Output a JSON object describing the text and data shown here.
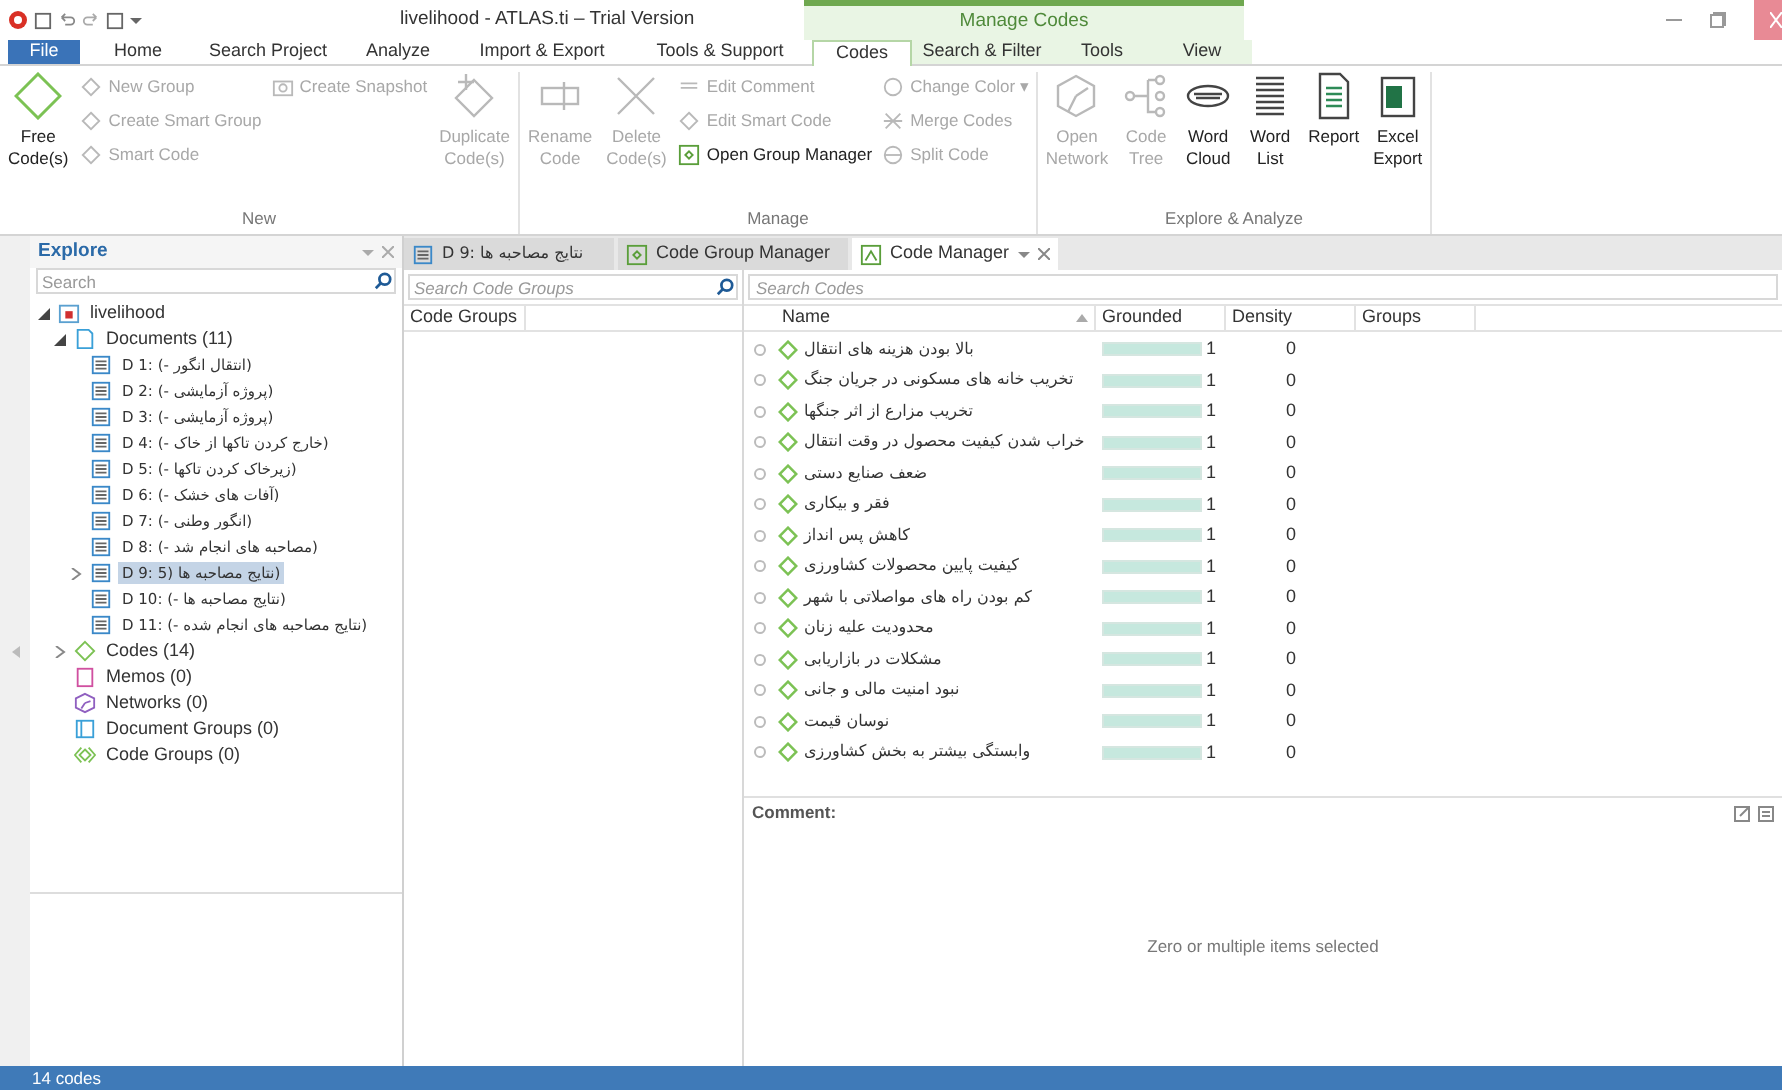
{
  "window": {
    "title": "livelihood - ATLAS.ti – Trial Version",
    "context_title": "Manage Codes"
  },
  "menu_tabs": [
    {
      "label": "File",
      "kind": "file",
      "selected": false,
      "context": false
    },
    {
      "label": "Home",
      "kind": "tab",
      "selected": false,
      "context": false
    },
    {
      "label": "Search Project",
      "kind": "tab",
      "selected": false,
      "context": false
    },
    {
      "label": "Analyze",
      "kind": "tab",
      "selected": false,
      "context": false
    },
    {
      "label": "Import & Export",
      "kind": "tab",
      "selected": false,
      "context": false
    },
    {
      "label": "Tools & Support",
      "kind": "tab",
      "selected": false,
      "context": false
    },
    {
      "label": "Codes",
      "kind": "tab",
      "selected": true,
      "context": true
    },
    {
      "label": "Search & Filter",
      "kind": "tab",
      "selected": false,
      "context": true
    },
    {
      "label": "Tools",
      "kind": "tab",
      "selected": false,
      "context": true
    },
    {
      "label": "View",
      "kind": "tab",
      "selected": false,
      "context": true
    }
  ],
  "ribbon": [
    {
      "label": "New",
      "columns": [
        {
          "kind": "large",
          "lines": [
            "Free",
            "Code(s)"
          ],
          "disabled": false
        },
        {
          "kind": "stack",
          "items": [
            {
              "label": "New Group",
              "disabled": true
            },
            {
              "label": "Create Smart Group",
              "disabled": true
            },
            {
              "label": "Smart Code",
              "disabled": true
            }
          ]
        },
        {
          "kind": "stack",
          "items": [
            {
              "label": "Create Snapshot",
              "disabled": true
            }
          ]
        },
        {
          "kind": "large",
          "lines": [
            "Duplicate",
            "Code(s)"
          ],
          "disabled": true
        }
      ]
    },
    {
      "label": "Manage",
      "columns": [
        {
          "kind": "large",
          "lines": [
            "Rename",
            "Code"
          ],
          "disabled": true
        },
        {
          "kind": "large",
          "lines": [
            "Delete",
            "Code(s)"
          ],
          "disabled": true
        },
        {
          "kind": "stack",
          "items": [
            {
              "label": "Edit Comment",
              "disabled": true
            },
            {
              "label": "Edit Smart Code",
              "disabled": true
            },
            {
              "label": "Open Group Manager",
              "disabled": false
            }
          ]
        },
        {
          "kind": "stack",
          "items": [
            {
              "label": "Change Color ▾",
              "disabled": true
            },
            {
              "label": "Merge Codes",
              "disabled": true
            },
            {
              "label": "Split Code",
              "disabled": true
            }
          ]
        }
      ]
    },
    {
      "label": "Explore & Analyze",
      "columns": [
        {
          "kind": "large",
          "lines": [
            "Open",
            "Network"
          ],
          "disabled": true
        },
        {
          "kind": "large",
          "lines": [
            "Code",
            "Tree"
          ],
          "disabled": true
        },
        {
          "kind": "large",
          "lines": [
            "Word",
            "Cloud"
          ],
          "disabled": false
        },
        {
          "kind": "large",
          "lines": [
            "Word",
            "List"
          ],
          "disabled": false
        },
        {
          "kind": "large",
          "lines": [
            "Report"
          ],
          "disabled": false
        },
        {
          "kind": "large",
          "lines": [
            "Excel",
            "Export"
          ],
          "disabled": false
        }
      ]
    }
  ],
  "explore": {
    "title": "Explore",
    "search": {
      "placeholder": "Search"
    },
    "tree": [
      {
        "kind": "project",
        "label": "livelihood",
        "expanded": true,
        "selected": false,
        "children": [
          {
            "kind": "documents",
            "label": "Documents (11)",
            "expanded": true,
            "selected": false,
            "children": [
              {
                "kind": "doc",
                "label": "D 1: (- انتقال انگور)",
                "selected": false
              },
              {
                "kind": "doc",
                "label": "D 2: (- پروژه آزمایشی)",
                "selected": false
              },
              {
                "kind": "doc",
                "label": "D 3: (- پروژه آزمایشی)",
                "selected": false
              },
              {
                "kind": "doc",
                "label": "D 4: (- خارج کردن تاکها از خاک)",
                "selected": false
              },
              {
                "kind": "doc",
                "label": "D 5: (- زیرخاک کردن تاکها)",
                "selected": false
              },
              {
                "kind": "doc",
                "label": "D 6: (- آفات های خشک)",
                "selected": false
              },
              {
                "kind": "doc",
                "label": "D 7: (- انگور وطنی)",
                "selected": false
              },
              {
                "kind": "doc",
                "label": "D 8: (- مصاحبه های انجام شد)",
                "selected": false
              },
              {
                "kind": "doc",
                "label": "D 9: 5) نتایج مصاحبه ها)",
                "selected": true,
                "expanded": false
              },
              {
                "kind": "doc",
                "label": "D 10: (- نتایج مصاحبه ها)",
                "selected": false
              },
              {
                "kind": "doc",
                "label": "D 11: (- نتایج مصاحبه های انجام شده)",
                "selected": false
              }
            ]
          },
          {
            "kind": "codes",
            "label": "Codes (14)",
            "expanded": false,
            "selected": false
          },
          {
            "kind": "memos",
            "label": "Memos (0)",
            "selected": false
          },
          {
            "kind": "networks",
            "label": "Networks (0)",
            "selected": false
          },
          {
            "kind": "docgroups",
            "label": "Document Groups (0)",
            "selected": false
          },
          {
            "kind": "codegroups",
            "label": "Code Groups (0)",
            "selected": false
          }
        ]
      }
    ]
  },
  "doc_tabs": [
    {
      "kind": "doc",
      "label": "D 9: نتایج مصاحبه ها",
      "selected": false
    },
    {
      "kind": "groupmanager",
      "label": "Code Group Manager",
      "selected": false
    },
    {
      "kind": "codemanager",
      "label": "Code Manager",
      "selected": true
    }
  ],
  "code_groups": {
    "search": {
      "placeholder": "Search Code Groups"
    },
    "column": "Code Groups"
  },
  "codes": {
    "search": {
      "placeholder": "Search Codes"
    },
    "columns": [
      "Name",
      "Grounded",
      "Density",
      "Groups"
    ],
    "rows": [
      {
        "name": "بالا بودن هزینه های انتقال",
        "grounded": "1",
        "level": 1,
        "density": "0"
      },
      {
        "name": "تخریب خانه های مسکونی در جریان جنگ",
        "grounded": "1",
        "level": 1,
        "density": "0"
      },
      {
        "name": "تخریب مزارع از اثر جنگها",
        "grounded": "1",
        "level": 1,
        "density": "0"
      },
      {
        "name": "خراب شدن کیفیت محصول در وقت انتقال",
        "grounded": "1",
        "level": 1,
        "density": "0"
      },
      {
        "name": "ضعف صنایع دستی",
        "grounded": "1",
        "level": 1,
        "density": "0"
      },
      {
        "name": "فقر و بیکاری",
        "grounded": "1",
        "level": 1,
        "density": "0"
      },
      {
        "name": "کاهش پس انداز",
        "grounded": "1",
        "level": 1,
        "density": "0"
      },
      {
        "name": "کیفیت پایین محصولات کشاورزی",
        "grounded": "1",
        "level": 1,
        "density": "0"
      },
      {
        "name": "کم بودن راه های مواصلاتی با شهر",
        "grounded": "1",
        "level": 1,
        "density": "0"
      },
      {
        "name": "محدودیت علیه زنان",
        "grounded": "1",
        "level": 1,
        "density": "0"
      },
      {
        "name": "مشکلات در بازاریابی",
        "grounded": "1",
        "level": 1,
        "density": "0"
      },
      {
        "name": "نبود امنیت مالی و جانی",
        "grounded": "1",
        "level": 1,
        "density": "0"
      },
      {
        "name": "نوسان قیمت",
        "grounded": "1",
        "level": 1,
        "density": "0"
      },
      {
        "name": "وابستگی بیشتر به بخش کشاورزی",
        "grounded": "1",
        "level": 1,
        "density": "0"
      }
    ],
    "comment_label": "Comment:",
    "comment_message": "Zero or multiple items selected"
  },
  "status_bar": "14 codes"
}
